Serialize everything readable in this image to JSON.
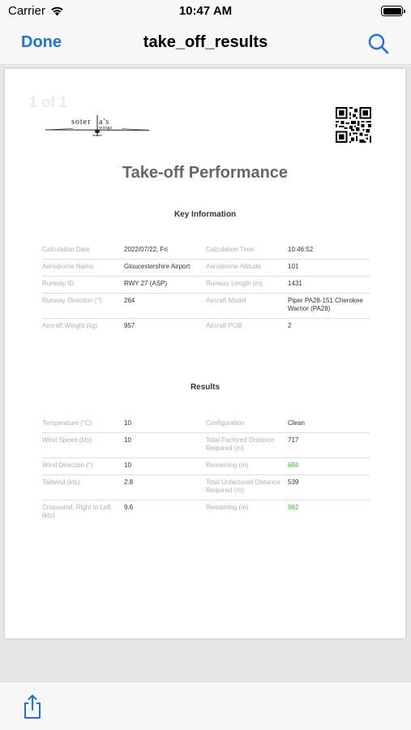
{
  "status_bar": {
    "carrier": "Carrier",
    "time": "10:47 AM",
    "wifi_icon": "wifi-icon",
    "battery_icon": "battery-icon"
  },
  "nav": {
    "done_label": "Done",
    "title": "take_off_results",
    "search_icon": "search-icon"
  },
  "document": {
    "page_indicator": "1 of 1",
    "logo_text": "soteria's wings",
    "title": "Take-off Performance",
    "key_info_heading": "Key Information",
    "key_info_rows": [
      {
        "l1": "Calculation Date",
        "v1": "2022/07/22, Fri",
        "l2": "Calculation Time",
        "v2": "10:46:52"
      },
      {
        "l1": "Aerodrome Name",
        "v1": "Gloucestershire Airport",
        "l2": "Aerodrome Altitude",
        "v2": "101"
      },
      {
        "l1": "Runway ID",
        "v1": "RWY 27 (ASP)",
        "l2": "Runway Length (m)",
        "v2": "1431"
      },
      {
        "l1": "Runway Direction (°)",
        "v1": "264",
        "l2": "Aircraft Model",
        "v2": "Piper PA28-151 Cherokee Warrior (PA28)"
      },
      {
        "l1": "Aircraft Weight (kg)",
        "v1": "957",
        "l2": "Aircraft POB",
        "v2": "2"
      }
    ],
    "results_heading": "Results",
    "results_rows": [
      {
        "l1": "Temperature (°C)",
        "v1": "10",
        "l2": "Configuration",
        "v2": "Clean"
      },
      {
        "l1": "Wind Speed (kts)",
        "v1": "10",
        "l2": "Total Factored Distance Required (m)",
        "v2": "717"
      },
      {
        "l1": "Wind Direction (°)",
        "v1": "10",
        "l2": "Remaining (m)",
        "v2": "684",
        "v2_color": "green"
      },
      {
        "l1": "Tailwind (kts)",
        "v1": "2.8",
        "l2": "Total Unfactored Distance Required (m)",
        "v2": "539"
      },
      {
        "l1": "Crosswind, Right to Left (kts)",
        "v1": "9.6",
        "l2": "Remaining (m)",
        "v2": "862",
        "v2_color": "green"
      }
    ]
  },
  "toolbar": {
    "share_icon": "share-icon"
  },
  "colors": {
    "accent": "#1a73e8",
    "title": "#6d6466",
    "positive": "#2ecc2e"
  }
}
